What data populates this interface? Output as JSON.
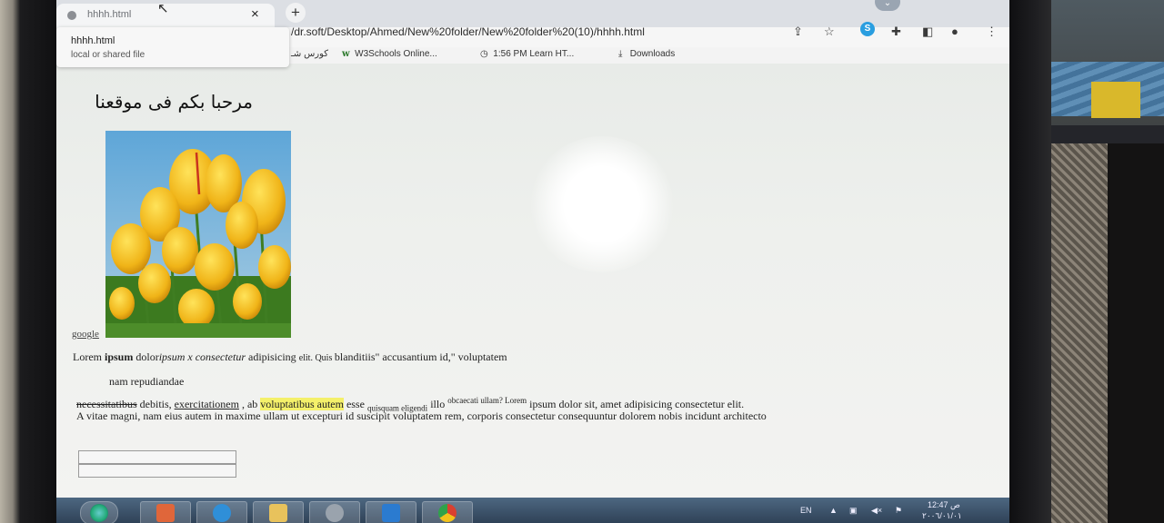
{
  "browser": {
    "tab_title": "hhhh.html",
    "url": "/dr.soft/Desktop/Ahmed/New%20folder/New%20folder%20(10)/hhhh.html",
    "tooltip": {
      "title": "hhhh.html",
      "subtitle": "local or shared file"
    },
    "new_tab_glyph": "+",
    "close_glyph": "×",
    "bookmarks": [
      {
        "label": "كورس شـ",
        "icon": "bookmark-icon"
      },
      {
        "label": "W3Schools Online...",
        "icon": "w3schools-icon"
      },
      {
        "label": "1:56 PM  Learn HT...",
        "icon": "clock-icon"
      },
      {
        "label": "Downloads",
        "icon": "download-icon"
      }
    ]
  },
  "page": {
    "heading": "مرحبا بكم فى موقعنا",
    "image_alt": "yellow tulips",
    "link_google": "google",
    "p1": {
      "a": "Lorem ",
      "b": "ipsum",
      "c": " dolor",
      "d": "ipsum x consectetur",
      "e": " adipisicing ",
      "f": "elit. Quis ",
      "g": "blanditiis\" accusantium id,\" voluptatem"
    },
    "p2": "nam repudiandae",
    "p3": {
      "strike": "necessitatibus",
      "a": " debitis, ",
      "ul": "exercitationem",
      "b": " , ab ",
      "hl": "voluptatibus autem",
      "c": " esse ",
      "sub": "quisquam eligendi",
      "d": " illo ",
      "sup": "obcaecati ullam? Lorem",
      "e": " ipsum dolor sit, amet adipisicing consectetur elit."
    },
    "p4": "A vitae magni, nam eius autem in maxime ullam ut excepturi id suscipit voluptatem rem, corporis consectetur consequuntur dolorem nobis incidunt architecto"
  },
  "taskbar": {
    "language": "EN",
    "time": "12:47 ص",
    "date": "٢٠٠٦/٠١/٠١",
    "apps": [
      "media-player-icon",
      "ie-icon",
      "folder-icon",
      "settings-icon",
      "vscode-icon",
      "chrome-icon"
    ]
  },
  "colors": {
    "highlight": "#f4f06a",
    "taskbar": "#2f4257"
  }
}
